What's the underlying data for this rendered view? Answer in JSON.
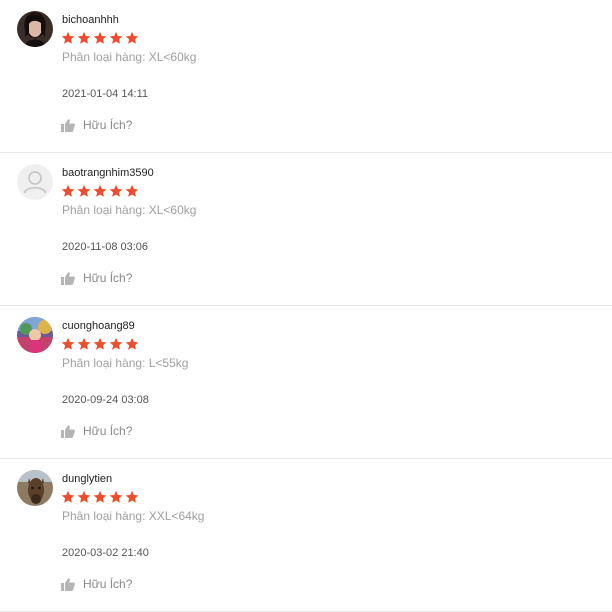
{
  "reviews": [
    {
      "username": "bichoanhhh",
      "rating": 5,
      "variation_prefix": "Phân loại hàng: ",
      "variation_value": "XL<60kg",
      "timestamp": "2021-01-04 14:11",
      "helpful_label": "Hữu Ích?",
      "avatar": "photo-dark-hair"
    },
    {
      "username": "baotrangnhim3590",
      "rating": 5,
      "variation_prefix": "Phân loại hàng: ",
      "variation_value": "XL<60kg",
      "timestamp": "2020-11-08 03:06",
      "helpful_label": "Hữu Ích?",
      "avatar": "default-user-icon"
    },
    {
      "username": "cuonghoang89",
      "rating": 5,
      "variation_prefix": "Phân loại hàng: ",
      "variation_value": "L<55kg",
      "timestamp": "2020-09-24 03:08",
      "helpful_label": "Hữu Ích?",
      "avatar": "photo-colorful"
    },
    {
      "username": "dunglytien",
      "rating": 5,
      "variation_prefix": "Phân loại hàng: ",
      "variation_value": "XXL<64kg",
      "timestamp": "2020-03-02 21:40",
      "helpful_label": "Hữu Ích?",
      "avatar": "photo-horse"
    }
  ],
  "colors": {
    "star": "#ee4d2d",
    "muted_text": "#a0a0a0",
    "divider": "#e8e8e8",
    "thumb_icon": "#b5b5b5"
  }
}
